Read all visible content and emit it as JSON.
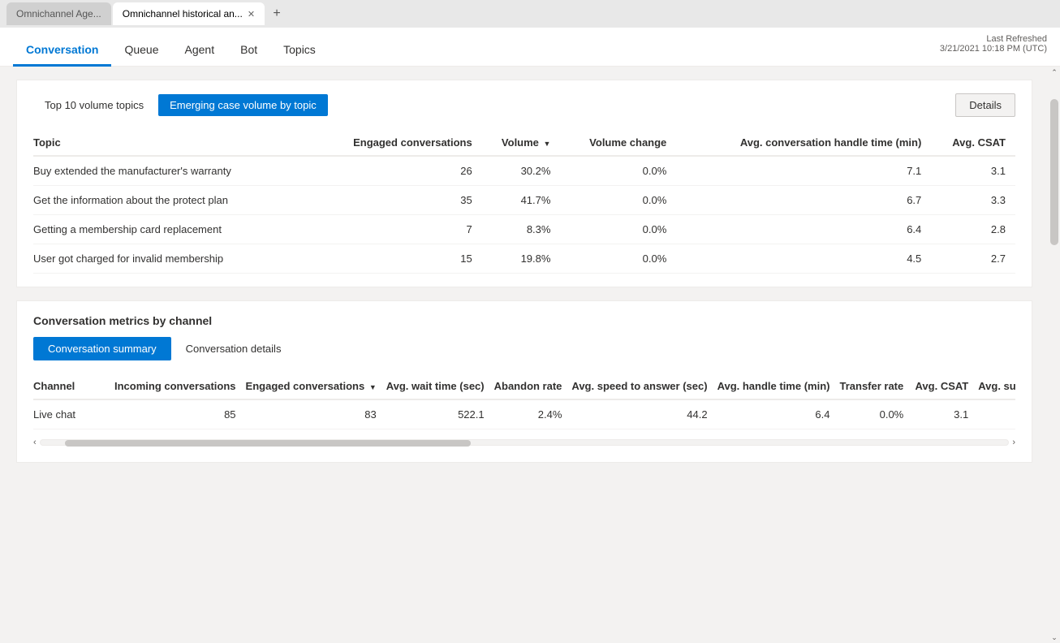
{
  "browser": {
    "tabs": [
      {
        "id": "tab1",
        "label": "Omnichannel Age...",
        "active": false
      },
      {
        "id": "tab2",
        "label": "Omnichannel historical an...",
        "active": true
      }
    ],
    "add_tab_label": "+"
  },
  "nav": {
    "tabs": [
      {
        "id": "conversation",
        "label": "Conversation",
        "active": true
      },
      {
        "id": "queue",
        "label": "Queue",
        "active": false
      },
      {
        "id": "agent",
        "label": "Agent",
        "active": false
      },
      {
        "id": "bot",
        "label": "Bot",
        "active": false
      },
      {
        "id": "topics",
        "label": "Topics",
        "active": false
      }
    ],
    "last_refreshed_label": "Last Refreshed",
    "last_refreshed_value": "3/21/2021 10:18 PM (UTC)"
  },
  "topics_section": {
    "tab_top10": "Top 10 volume topics",
    "tab_emerging": "Emerging case volume by topic",
    "details_btn": "Details",
    "table": {
      "columns": [
        {
          "id": "topic",
          "label": "Topic",
          "align": "left"
        },
        {
          "id": "engaged",
          "label": "Engaged conversations",
          "align": "right"
        },
        {
          "id": "volume",
          "label": "Volume",
          "align": "right",
          "sort": true
        },
        {
          "id": "volume_change",
          "label": "Volume change",
          "align": "right"
        },
        {
          "id": "avg_handle",
          "label": "Avg. conversation handle time (min)",
          "align": "right"
        },
        {
          "id": "avg_csat",
          "label": "Avg. CSAT",
          "align": "right"
        }
      ],
      "rows": [
        {
          "topic": "Buy extended the manufacturer's warranty",
          "engaged": "26",
          "volume": "30.2%",
          "volume_change": "0.0%",
          "avg_handle": "7.1",
          "avg_csat": "3.1"
        },
        {
          "topic": "Get the information about the protect plan",
          "engaged": "35",
          "volume": "41.7%",
          "volume_change": "0.0%",
          "avg_handle": "6.7",
          "avg_csat": "3.3"
        },
        {
          "topic": "Getting a membership card replacement",
          "engaged": "7",
          "volume": "8.3%",
          "volume_change": "0.0%",
          "avg_handle": "6.4",
          "avg_csat": "2.8"
        },
        {
          "topic": "User got charged for invalid membership",
          "engaged": "15",
          "volume": "19.8%",
          "volume_change": "0.0%",
          "avg_handle": "4.5",
          "avg_csat": "2.7"
        }
      ]
    }
  },
  "metrics_section": {
    "title": "Conversation metrics by channel",
    "tab_summary": "Conversation summary",
    "tab_details": "Conversation details",
    "channel_table": {
      "columns": [
        {
          "id": "channel",
          "label": "Channel",
          "align": "left"
        },
        {
          "id": "incoming",
          "label": "Incoming conversations",
          "align": "right"
        },
        {
          "id": "engaged",
          "label": "Engaged conversations",
          "align": "right",
          "sort": true
        },
        {
          "id": "avg_wait",
          "label": "Avg. wait time (sec)",
          "align": "right"
        },
        {
          "id": "abandon_rate",
          "label": "Abandon rate",
          "align": "right"
        },
        {
          "id": "avg_speed",
          "label": "Avg. speed to answer (sec)",
          "align": "right"
        },
        {
          "id": "avg_handle",
          "label": "Avg. handle time (min)",
          "align": "right"
        },
        {
          "id": "transfer_rate",
          "label": "Transfer rate",
          "align": "right"
        },
        {
          "id": "avg_csat",
          "label": "Avg. CSAT",
          "align": "right"
        },
        {
          "id": "avg_survey",
          "label": "Avg. survey se",
          "align": "right"
        }
      ],
      "rows": [
        {
          "channel": "Live chat",
          "incoming": "85",
          "engaged": "83",
          "avg_wait": "522.1",
          "abandon_rate": "2.4%",
          "avg_speed": "44.2",
          "avg_handle": "6.4",
          "transfer_rate": "0.0%",
          "avg_csat": "3.1",
          "avg_survey": ""
        }
      ]
    }
  }
}
